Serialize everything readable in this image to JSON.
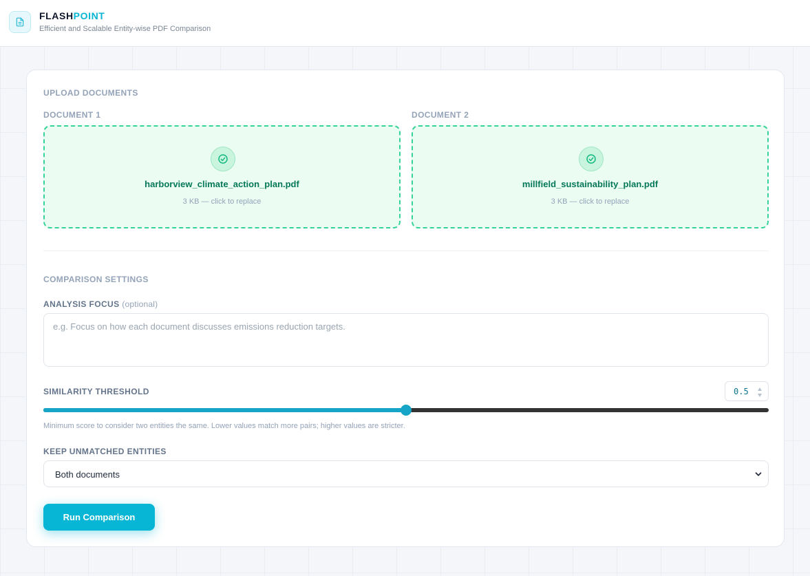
{
  "header": {
    "brand_primary": "FLASH",
    "brand_accent": "POINT",
    "tagline": "Efficient and Scalable Entity-wise PDF Comparison",
    "logo_icon": "document-icon",
    "accent_color": "#06b6d4"
  },
  "upload": {
    "section_title": "UPLOAD DOCUMENTS",
    "documents": [
      {
        "label": "DOCUMENT 1",
        "file_name": "harborview_climate_action_plan.pdf",
        "meta": "3 KB — click to replace",
        "status_icon": "check-circle-icon"
      },
      {
        "label": "DOCUMENT 2",
        "file_name": "millfield_sustainability_plan.pdf",
        "meta": "3 KB — click to replace",
        "status_icon": "check-circle-icon"
      }
    ],
    "success_color": "#34d399"
  },
  "settings": {
    "section_title": "COMPARISON SETTINGS",
    "analysis_focus": {
      "label": "ANALYSIS FOCUS",
      "optional_note": "(optional)",
      "placeholder": "e.g. Focus on how each document discusses emissions reduction targets.",
      "value": ""
    },
    "similarity_threshold": {
      "label": "SIMILARITY THRESHOLD",
      "value": "0.5",
      "fraction": 0.5,
      "help": "Minimum score to consider two entities the same. Lower values match more pairs; higher values are stricter."
    },
    "keep_unmatched": {
      "label": "KEEP UNMATCHED ENTITIES",
      "selected": "Both documents"
    },
    "run_button_label": "Run Comparison"
  }
}
